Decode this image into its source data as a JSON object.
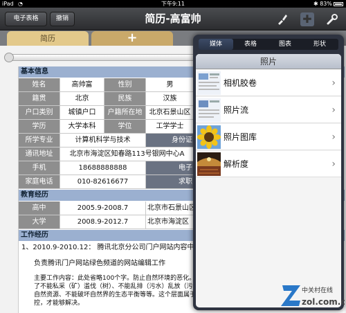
{
  "status": {
    "carrier": "iPad",
    "time": "下午9:11",
    "battery": "83%"
  },
  "toolbar": {
    "spreadsheet_label": "电子表格",
    "undo_label": "撤销",
    "title": "简历-高富帅"
  },
  "tabs": {
    "first": "简历",
    "add": "+"
  },
  "resume": {
    "basic_title": "基本信息",
    "rows": [
      [
        "姓名",
        "高帅富",
        "性别",
        "男"
      ],
      [
        "籍贯",
        "北京",
        "民族",
        "汉族"
      ],
      [
        "户口类别",
        "城镇户口",
        "户籍所在地",
        "北京石景山区"
      ],
      [
        "学历",
        "大学本科",
        "学位",
        "工学学士"
      ]
    ],
    "major_label": "所学专业",
    "major_value": "计算机科学与技术",
    "id_label": "身份证",
    "address_label": "通讯地址",
    "address_value": "北京市海淀区知春路113号银网中心A",
    "phone_label": "手机",
    "phone_value": "18688888888",
    "email_label": "电子",
    "home_label": "家庭电话",
    "home_value": "010-82616677",
    "job_label": "求职",
    "edu_title": "教育经历",
    "edu_rows": [
      [
        "高中",
        "2005.9-2008.7",
        "北京市石景山区"
      ],
      [
        "大学",
        "2008.9-2012.7",
        "北京市海淀区"
      ]
    ],
    "work_title": "工作经历",
    "work_line1": "1、2010.9-2010.12：  腾讯北京分公司门户网站内容中心网站编辑",
    "work_line2": "负责腾讯门户网站绿色频道的网站编辑工作",
    "work_line3": "主要工作内容：此处省略100个字。防止自然环境的恶化。包括：对青山、绿水、蓝天、…的保护；…就涉及到了不能私采（矿）滥伐（树）、不能乱排（污水）乱放（污气）、不能过度放牧；不能过度开垦，不能 过度开发自然资源、不能破坏自然界的生态平衡等等。这个层面属于宏观的。主要依靠各级政府行使自己的职能 进行调控，才能够解决。"
  },
  "popover": {
    "segments": [
      "媒体",
      "表格",
      "图表",
      "形状"
    ],
    "selected_segment": 0,
    "header": "照片",
    "items": [
      "相机胶卷",
      "照片流",
      "照片图库",
      "解析度"
    ]
  },
  "watermark": {
    "text": "zol.com.cn",
    "sub": "中关村在线"
  },
  "colors": {
    "section": "#9bb0d0",
    "header_cell": "#8e8e8e",
    "tab": "#e3c98b"
  }
}
